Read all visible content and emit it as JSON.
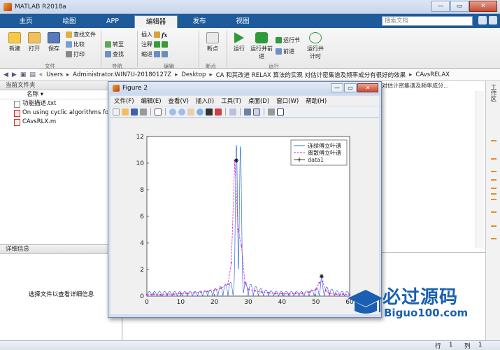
{
  "window": {
    "title": "MATLAB R2018a",
    "minimize": "—",
    "maximize": "▭",
    "close": "✕"
  },
  "tabs": [
    {
      "label": "主页"
    },
    {
      "label": "绘图"
    },
    {
      "label": "APP"
    },
    {
      "label": "编辑器"
    },
    {
      "label": "发布"
    },
    {
      "label": "视图"
    }
  ],
  "search": {
    "placeholder": "搜索文档"
  },
  "ribbon": {
    "new": "新建",
    "open": "打开",
    "save": "保存",
    "find_files": "查找文件",
    "compare": "比较",
    "print": "打印",
    "insert": "插入",
    "comment": "注释",
    "indent": "缩进",
    "goto": "转至",
    "find": "查找",
    "breakpoint": "断点",
    "run": "运行",
    "run_advance": "运行并前进",
    "run_section": "运行节",
    "advance": "前进",
    "run_time": "运行并计时",
    "groups": {
      "file": "文件",
      "nav": "导航",
      "edit": "编辑",
      "breakpoints": "断点",
      "run": "运行"
    },
    "fx": "fx"
  },
  "address": {
    "segments": [
      "Users",
      "Administrator.WIN7U-20180127Z",
      "Desktop",
      "CA 和其改进 RELAX 算法的实现 对估计密集谱及频率成分有很好的效果",
      "CAvsRELAX"
    ]
  },
  "left_panel": {
    "header": "当前文件夹",
    "column": "名称",
    "files": [
      {
        "name": "功能描述.txt",
        "type": "txt"
      },
      {
        "name": "On using cyclic algorithms for",
        "type": "pdf"
      },
      {
        "name": "CAvsRLX.m",
        "type": "m"
      }
    ],
    "detail_header": "详细信息",
    "detail_message": "选择文件以查看详细信息"
  },
  "editor": {
    "tab_title": "对估计密集谱及频率成分..."
  },
  "workspace": {
    "label": "工作区"
  },
  "status": {
    "line_label": "行",
    "line_value": "1",
    "col_label": "列",
    "col_value": "1"
  },
  "figure": {
    "title": "Figure 2",
    "menus": [
      "文件(F)",
      "编辑(E)",
      "查看(V)",
      "插入(I)",
      "工具(T)",
      "桌面(D)",
      "窗口(W)",
      "帮助(H)"
    ]
  },
  "watermark": {
    "text": "必过源码",
    "sub": "Biguo100.com"
  },
  "chart_data": {
    "type": "line",
    "title": "",
    "xlabel": "",
    "ylabel": "",
    "xlim": [
      0,
      60
    ],
    "ylim": [
      0,
      12
    ],
    "xticks": [
      0,
      10,
      20,
      30,
      40,
      50,
      60
    ],
    "yticks": [
      0,
      2,
      4,
      6,
      8,
      10,
      12
    ],
    "legend_position": "top-right",
    "series": [
      {
        "name": "连续傅立叶谱",
        "color": "#2f6fd6",
        "style": "line",
        "peaks": [
          {
            "x": 26.5,
            "y": 11.4,
            "w": 0.55
          },
          {
            "x": 27.7,
            "y": 11.3,
            "w": 0.55
          },
          {
            "x": 51.7,
            "y": 1.5,
            "w": 0.5
          }
        ],
        "sidelobe_level": 0.35,
        "sidelobe_period": 1.5
      },
      {
        "name": "离散傅立叶谱",
        "color": "#e022e0",
        "style": "dashdot-markers",
        "points": [
          [
            0,
            0.1
          ],
          [
            2,
            0.15
          ],
          [
            4,
            0.1
          ],
          [
            6,
            0.15
          ],
          [
            8,
            0.15
          ],
          [
            10,
            0.2
          ],
          [
            12,
            0.2
          ],
          [
            14,
            0.25
          ],
          [
            16,
            0.3
          ],
          [
            18,
            0.35
          ],
          [
            20,
            0.45
          ],
          [
            22,
            0.6
          ],
          [
            24,
            0.9
          ],
          [
            25,
            2.5
          ],
          [
            26,
            10.2
          ],
          [
            27,
            5.0
          ],
          [
            28,
            3.8
          ],
          [
            29,
            1.0
          ],
          [
            30,
            0.5
          ],
          [
            32,
            0.4
          ],
          [
            34,
            0.3
          ],
          [
            36,
            0.25
          ],
          [
            38,
            0.2
          ],
          [
            40,
            0.2
          ],
          [
            42,
            0.15
          ],
          [
            44,
            0.2
          ],
          [
            46,
            0.2
          ],
          [
            48,
            0.3
          ],
          [
            50,
            0.5
          ],
          [
            51,
            1.0
          ],
          [
            52,
            1.1
          ],
          [
            53,
            0.4
          ],
          [
            54,
            0.2
          ],
          [
            56,
            0.15
          ],
          [
            58,
            0.15
          ],
          [
            60,
            0.1
          ]
        ]
      },
      {
        "name": "data1",
        "color": "#111111",
        "style": "star",
        "points": [
          [
            26.5,
            10.2
          ],
          [
            51.7,
            1.5
          ]
        ]
      }
    ]
  }
}
